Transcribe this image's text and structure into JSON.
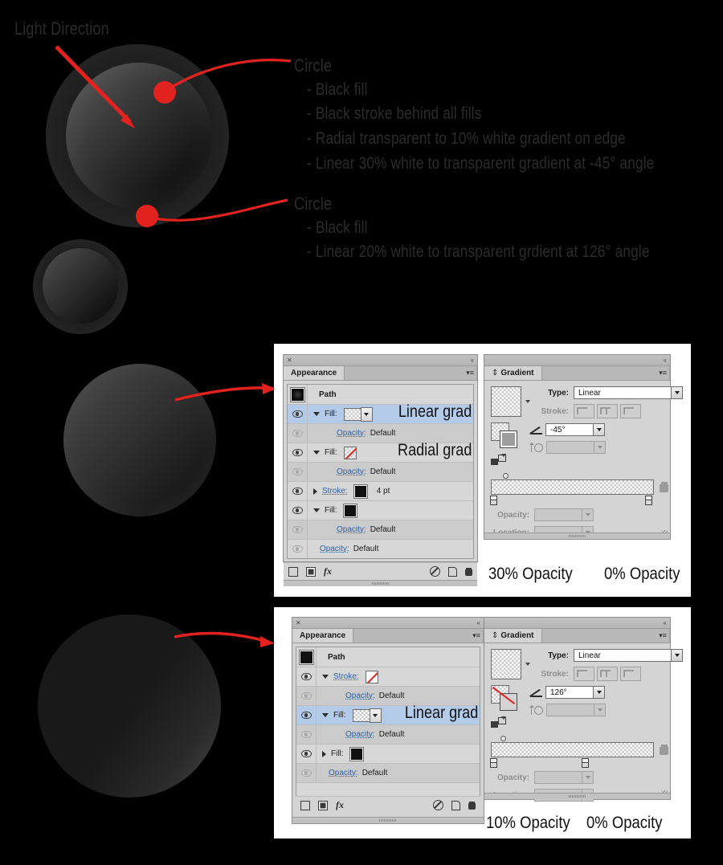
{
  "illustration": {
    "light_direction_label": "Light Direction",
    "callouts": [
      {
        "title": "Circle",
        "bullets": [
          "- Black fill",
          "- Black stroke behind all fills",
          "- Radial transparent to 10% white gradient on edge",
          "- Linear 30% white to transparent gradient at -45° angle"
        ]
      },
      {
        "title": "Circle",
        "bullets": [
          "- Black fill",
          "- Linear 20% white to transparent grdient at 126° angle"
        ]
      }
    ]
  },
  "colors": {
    "accent_red": "#e2221e",
    "panel_gray": "#d4d4d4",
    "selection_blue": "#b3cbe8",
    "link_blue": "#2b5fa5",
    "text_gray": "#2b2b2b"
  },
  "panel_group_1": {
    "appearance": {
      "tab_label": "Appearance",
      "close_glyph": "✕",
      "collapse_glyph": "«",
      "menu_glyph": "▾≡",
      "item_label": "Path",
      "rows": [
        {
          "label": "Fill:",
          "value": "",
          "swatch": "gradient-checker",
          "tag": "Linear grad",
          "eye": "on",
          "tri": "down",
          "selected": true
        },
        {
          "label": "Opacity:",
          "value": "Default",
          "swatch": "none",
          "tag": "",
          "eye": "off",
          "tri": "none",
          "selected": false
        },
        {
          "label": "Fill:",
          "value": "",
          "swatch": "checker",
          "tag": "Radial grad",
          "eye": "on",
          "tri": "down",
          "selected": false
        },
        {
          "label": "Opacity:",
          "value": "Default",
          "swatch": "none",
          "tag": "",
          "eye": "off",
          "tri": "none",
          "selected": false
        },
        {
          "label": "Stroke:",
          "value": "4 pt",
          "swatch": "black",
          "tag": "",
          "eye": "on",
          "tri": "right",
          "selected": false
        },
        {
          "label": "Fill:",
          "value": "",
          "swatch": "black",
          "tag": "",
          "eye": "on",
          "tri": "down",
          "selected": false
        },
        {
          "label": "Opacity:",
          "value": "Default",
          "swatch": "none",
          "tag": "",
          "eye": "off",
          "tri": "none",
          "selected": false
        },
        {
          "label": "Opacity:",
          "value": "Default",
          "swatch": "none",
          "tag": "",
          "eye": "off",
          "tri": "none",
          "selected": false
        }
      ]
    },
    "gradient": {
      "tab_label": "Gradient",
      "tab_glyph": "⇕",
      "collapse_glyph": "«",
      "menu_glyph": "▾≡",
      "type_label": "Type:",
      "type_value": "Linear",
      "stroke_label": "Stroke:",
      "angle_value": "-45°",
      "aspect_value": "",
      "opacity_label": "Opacity:",
      "opacity_value": "",
      "location_label": "Location:",
      "location_value": "",
      "stop_left_pct": 0,
      "stop_right_pct": 100,
      "midpoint_pct": 9
    },
    "annotations": {
      "left": "30% Opacity",
      "right": "0% Opacity"
    }
  },
  "panel_group_2": {
    "appearance": {
      "tab_label": "Appearance",
      "close_glyph": "✕",
      "collapse_glyph": "«",
      "menu_glyph": "▾≡",
      "item_label": "Path",
      "rows": [
        {
          "label": "Stroke:",
          "value": "",
          "swatch": "no-color",
          "tag": "",
          "eye": "on",
          "tri": "down",
          "selected": false
        },
        {
          "label": "Opacity:",
          "value": "Default",
          "swatch": "none",
          "tag": "",
          "eye": "off",
          "tri": "none",
          "selected": false
        },
        {
          "label": "Fill:",
          "value": "",
          "swatch": "gradient-checker",
          "tag": "Linear grad",
          "eye": "on",
          "tri": "down",
          "selected": true
        },
        {
          "label": "Opacity:",
          "value": "Default",
          "swatch": "none",
          "tag": "",
          "eye": "off",
          "tri": "none",
          "selected": false
        },
        {
          "label": "Fill:",
          "value": "",
          "swatch": "black",
          "tag": "",
          "eye": "on",
          "tri": "right",
          "selected": false
        },
        {
          "label": "Opacity:",
          "value": "Default",
          "swatch": "none",
          "tag": "",
          "eye": "off",
          "tri": "none",
          "selected": false
        }
      ]
    },
    "gradient": {
      "tab_label": "Gradient",
      "tab_glyph": "⇕",
      "collapse_glyph": "«",
      "menu_glyph": "▾≡",
      "type_label": "Type:",
      "type_value": "Linear",
      "stroke_label": "Stroke:",
      "angle_value": "126°",
      "aspect_value": "",
      "opacity_label": "Opacity:",
      "opacity_value": "",
      "location_label": "Location:",
      "location_value": "",
      "stop_left_pct": 0,
      "stop_right_pct": 56,
      "midpoint_pct": 7
    },
    "annotations": {
      "left": "10% Opacity",
      "right": "0% Opacity"
    }
  }
}
